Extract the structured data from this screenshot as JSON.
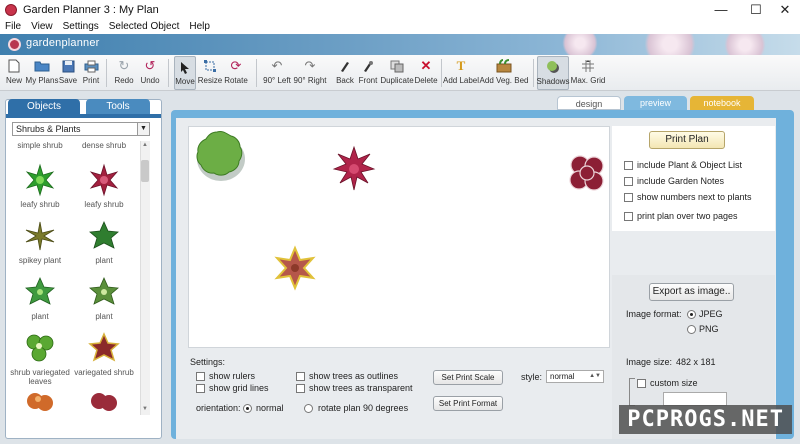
{
  "window": {
    "title": "Garden Planner 3 : My  Plan",
    "controls": {
      "minimize": "—",
      "maximize": "☐",
      "close": "✕"
    }
  },
  "menu": [
    "File",
    "View",
    "Settings",
    "Selected Object",
    "Help"
  ],
  "banner": {
    "brand": "gardenplanner"
  },
  "toolbar": {
    "file": [
      {
        "label": "New",
        "icon": "new-doc-icon"
      },
      {
        "label": "My Plans",
        "icon": "folder-icon"
      },
      {
        "label": "Save",
        "icon": "save-icon"
      },
      {
        "label": "Print",
        "icon": "print-icon"
      }
    ],
    "history": [
      {
        "label": "Redo",
        "icon": "redo-icon"
      },
      {
        "label": "Undo",
        "icon": "undo-icon"
      }
    ],
    "modes": [
      {
        "label": "Move",
        "icon": "cursor-icon",
        "pressed": true
      },
      {
        "label": "Resize",
        "icon": "resize-icon"
      },
      {
        "label": "Rotate",
        "icon": "rotate-icon"
      }
    ],
    "edit": [
      {
        "label": "90° Left",
        "icon": "rotate-left-icon"
      },
      {
        "label": "90° Right",
        "icon": "rotate-right-icon"
      },
      {
        "label": "Back",
        "icon": "send-back-icon"
      },
      {
        "label": "Front",
        "icon": "bring-front-icon"
      },
      {
        "label": "Duplicate",
        "icon": "duplicate-icon"
      },
      {
        "label": "Delete",
        "icon": "delete-icon"
      }
    ],
    "add": [
      {
        "label": "Add Label",
        "icon": "text-icon"
      },
      {
        "label": "Add Veg. Bed",
        "icon": "veg-bed-icon"
      }
    ],
    "view": [
      {
        "label": "Shadows",
        "icon": "shadows-icon",
        "pressed": true
      },
      {
        "label": "Max. Grid",
        "icon": "grid-icon"
      }
    ]
  },
  "left_panel": {
    "tabs": [
      "Objects",
      "Tools"
    ],
    "category": "Shrubs & Plants",
    "items": [
      {
        "label": "simple shrub",
        "color": "#6aa84f"
      },
      {
        "label": "dense shrub",
        "color": "#4f8a3a"
      },
      {
        "label": "leafy shrub",
        "color": "#2e9e2e"
      },
      {
        "label": "leafy shrub",
        "color": "#a3203f"
      },
      {
        "label": "spikey plant",
        "color": "#7a7a2a"
      },
      {
        "label": "plant",
        "color": "#2f7d2f"
      },
      {
        "label": "plant",
        "color": "#3f9a3f"
      },
      {
        "label": "plant",
        "color": "#5a8f3a"
      },
      {
        "label": "shrub variegated leaves",
        "color": "#5aa832"
      },
      {
        "label": "variegated shrub",
        "color": "#8b2a2a"
      },
      {
        "label": "",
        "color": "#d06a2a"
      },
      {
        "label": "",
        "color": "#9a2b3a"
      }
    ]
  },
  "right_tabs": [
    "design",
    "preview",
    "notebook"
  ],
  "print_panel": {
    "print_button": "Print Plan",
    "options": [
      {
        "label": "include Plant & Object List",
        "checked": false
      },
      {
        "label": "include Garden Notes",
        "checked": false
      },
      {
        "label": "show numbers next to plants",
        "checked": false
      },
      {
        "label": "print plan over two pages",
        "checked": false
      }
    ]
  },
  "export_panel": {
    "export_button": "Export as image..",
    "format_label": "Image format:",
    "formats": [
      {
        "label": "JPEG",
        "selected": true
      },
      {
        "label": "PNG",
        "selected": false
      }
    ],
    "size_label": "Image size:",
    "size_value": "482 x 181",
    "custom_size_label": "custom size"
  },
  "settings": {
    "heading": "Settings:",
    "checks": [
      {
        "label": "show rulers",
        "checked": false
      },
      {
        "label": "show grid lines",
        "checked": false
      },
      {
        "label": "show trees as outlines",
        "checked": false
      },
      {
        "label": "show trees as transparent",
        "checked": false
      }
    ],
    "orientation_label": "orientation:",
    "orientation_options": [
      {
        "label": "normal",
        "selected": true
      },
      {
        "label": "rotate plan 90 degrees",
        "selected": false
      }
    ],
    "set_print_scale": "Set Print Scale",
    "set_print_format": "Set Print Format",
    "style_label": "style:",
    "style_value": "normal"
  },
  "canvas_plants": [
    {
      "name": "green-shrub",
      "color": "#6cae45"
    },
    {
      "name": "red-leafy-shrub",
      "color": "#b0244a"
    },
    {
      "name": "dark-red-shrub",
      "color": "#8c1f35"
    },
    {
      "name": "variegated-plant",
      "color": "#b5574a"
    }
  ],
  "watermark": "PCPROGS.NET"
}
